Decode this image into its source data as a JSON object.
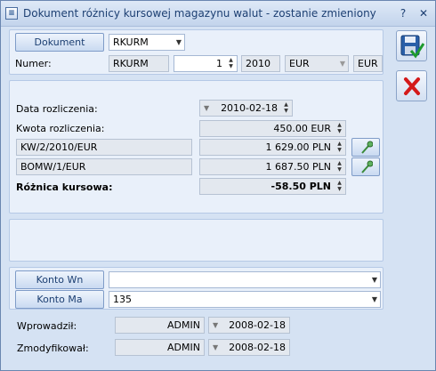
{
  "window": {
    "title": "Dokument różnicy kursowej magazynu walut - zostanie zmieniony",
    "help": "?",
    "close": "✕"
  },
  "document": {
    "button_label": "Dokument",
    "type_value": "RKURM",
    "number_label": "Numer:",
    "number_prefix": "RKURM",
    "number_value": "1",
    "number_year": "2010",
    "currency_select": "EUR",
    "currency_suffix": "EUR"
  },
  "settlement": {
    "date_label": "Data rozliczenia:",
    "date_value": "2010-02-18",
    "amount_label": "Kwota rozliczenia:",
    "amount_value": "450.00 EUR",
    "doc1_name": "KW/2/2010/EUR",
    "doc1_value": "1 629.00 PLN",
    "doc2_name": "BOMW/1/EUR",
    "doc2_value": "1 687.50 PLN",
    "diff_label": "Różnica kursowa:",
    "diff_value": "-58.50 PLN"
  },
  "accounts": {
    "wn_button": "Konto Wn",
    "wn_value": "",
    "ma_button": "Konto Ma",
    "ma_value": "135"
  },
  "audit": {
    "created_label": "Wprowadził:",
    "created_user": "ADMIN",
    "created_date": "2008-02-18",
    "modified_label": "Zmodyfikował:",
    "modified_user": "ADMIN",
    "modified_date": "2008-02-18"
  },
  "colors": {
    "save": "#2a5fa8",
    "cancel": "#d41a1a"
  }
}
